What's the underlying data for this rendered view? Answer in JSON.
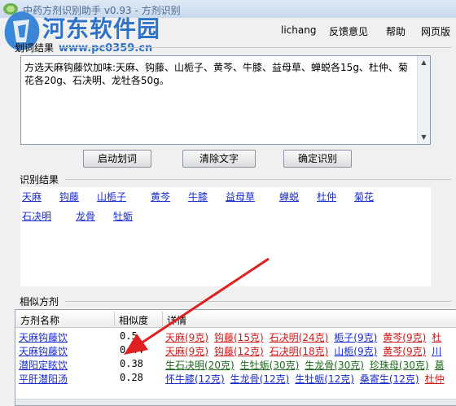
{
  "window": {
    "title": "中药方剂识别助手 v0.93 - 方剂识别"
  },
  "watermark": {
    "name": "河东软件园",
    "url": "www.pc0359.cn"
  },
  "menu": [
    "lichang",
    "反馈意见",
    "帮助",
    "网页版"
  ],
  "input_section": {
    "label": "划词结果",
    "text": "方选天麻钩藤饮加味:天麻、钩藤、山栀子、黄芩、牛膝、益母草、蝉蜕各15g、杜仲、菊花各20g、石决明、龙牡各50g。"
  },
  "buttons": {
    "start": "启动划词",
    "clear": "清除文字",
    "confirm": "确定识别"
  },
  "herb_section": {
    "label": "识别结果",
    "herbs": [
      "天麻",
      "钩藤",
      "山栀子",
      "黄芩",
      "牛膝",
      "益母草",
      "蝉蜕",
      "杜仲",
      "菊花",
      "石决明",
      "龙骨",
      "牡蛎"
    ]
  },
  "formula_section": {
    "label": "相似方剂",
    "columns": [
      "方剂名称",
      "相似度",
      "详情"
    ],
    "rows": [
      {
        "name": "天麻钩藤饮",
        "score": "0.5",
        "details": [
          "天麻(9克)",
          "钩藤(15克)",
          "石决明(24克)",
          "栀子(9克)",
          "黄芩(9克)",
          "杜"
        ]
      },
      {
        "name": "天麻钩藤饮",
        "score": "0.44",
        "details": [
          "天麻(9克)",
          "钩藤(12克)",
          "石决明(18克)",
          "山栀(9克)",
          "黄芩(9克)",
          "川"
        ]
      },
      {
        "name": "潜阳定眩饮",
        "score": "0.38",
        "details": [
          "生石决明(20克)",
          "生牡蛎(30克)",
          "生龙骨(30克)",
          "珍珠母(30克)",
          "葛"
        ]
      },
      {
        "name": "平肝潜阳汤",
        "score": "0.28",
        "details": [
          "怀牛膝(12克)",
          "生龙骨(12克)",
          "生牡蛎(12克)",
          "桑寄生(12克)",
          "杜仲"
        ]
      }
    ]
  },
  "colors": {
    "link_blue": "#1a2ccc",
    "match_red": "#cc1a1a",
    "other_green": "#1a6a1a",
    "arrow_red": "#e02020",
    "watermark_blue": "#2f73c9"
  }
}
